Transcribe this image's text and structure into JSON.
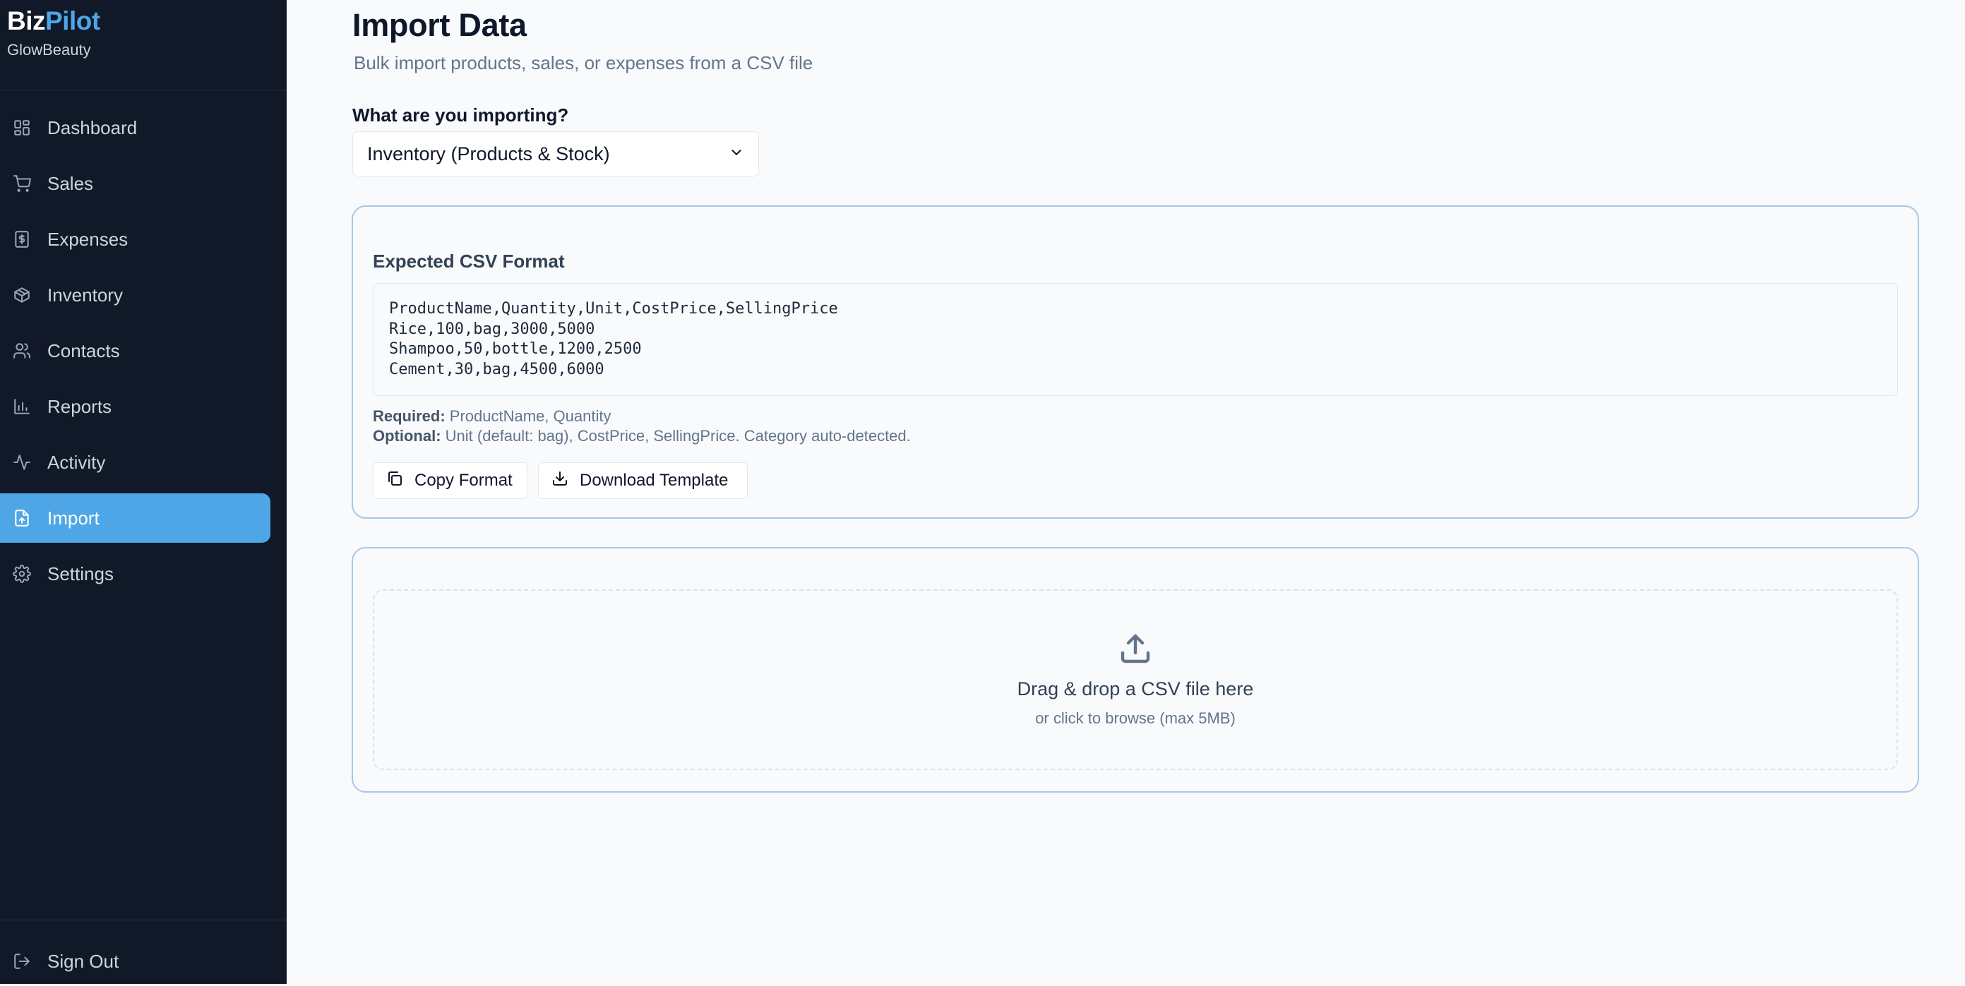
{
  "brand": {
    "logo_part1": "Biz",
    "logo_part2": "Pilot",
    "workspace": "GlowBeauty"
  },
  "sidebar": {
    "items": [
      {
        "label": "Dashboard",
        "icon": "dashboard-icon"
      },
      {
        "label": "Sales",
        "icon": "cart-icon"
      },
      {
        "label": "Expenses",
        "icon": "receipt-dollar-icon"
      },
      {
        "label": "Inventory",
        "icon": "box-icon"
      },
      {
        "label": "Contacts",
        "icon": "users-icon"
      },
      {
        "label": "Reports",
        "icon": "bar-chart-icon"
      },
      {
        "label": "Activity",
        "icon": "activity-icon"
      },
      {
        "label": "Import",
        "icon": "file-upload-icon",
        "active": true
      },
      {
        "label": "Settings",
        "icon": "gear-icon"
      }
    ],
    "signout_label": "Sign Out"
  },
  "page": {
    "title": "Import Data",
    "subtitle": "Bulk import products, sales, or expenses from a CSV file"
  },
  "import_type": {
    "label": "What are you importing?",
    "selected": "Inventory (Products & Stock)"
  },
  "format_card": {
    "title": "Expected CSV Format",
    "csv_lines": [
      "ProductName,Quantity,Unit,CostPrice,SellingPrice",
      "Rice,100,bag,3000,5000",
      "Shampoo,50,bottle,1200,2500",
      "Cement,30,bag,4500,6000"
    ],
    "required_label": "Required:",
    "required_text": " ProductName, Quantity",
    "optional_label": "Optional:",
    "optional_text": " Unit (default: bag), CostPrice, SellingPrice. Category auto-detected.",
    "copy_button": "Copy Format",
    "download_button": "Download Template"
  },
  "upload": {
    "title": "Drag & drop a CSV file here",
    "subtitle": "or click to browse (max 5MB)"
  },
  "colors": {
    "sidebar_bg": "#111827",
    "accent": "#4ea6e6",
    "card_border": "#a9c6e6",
    "page_bg": "#f8fafc"
  }
}
